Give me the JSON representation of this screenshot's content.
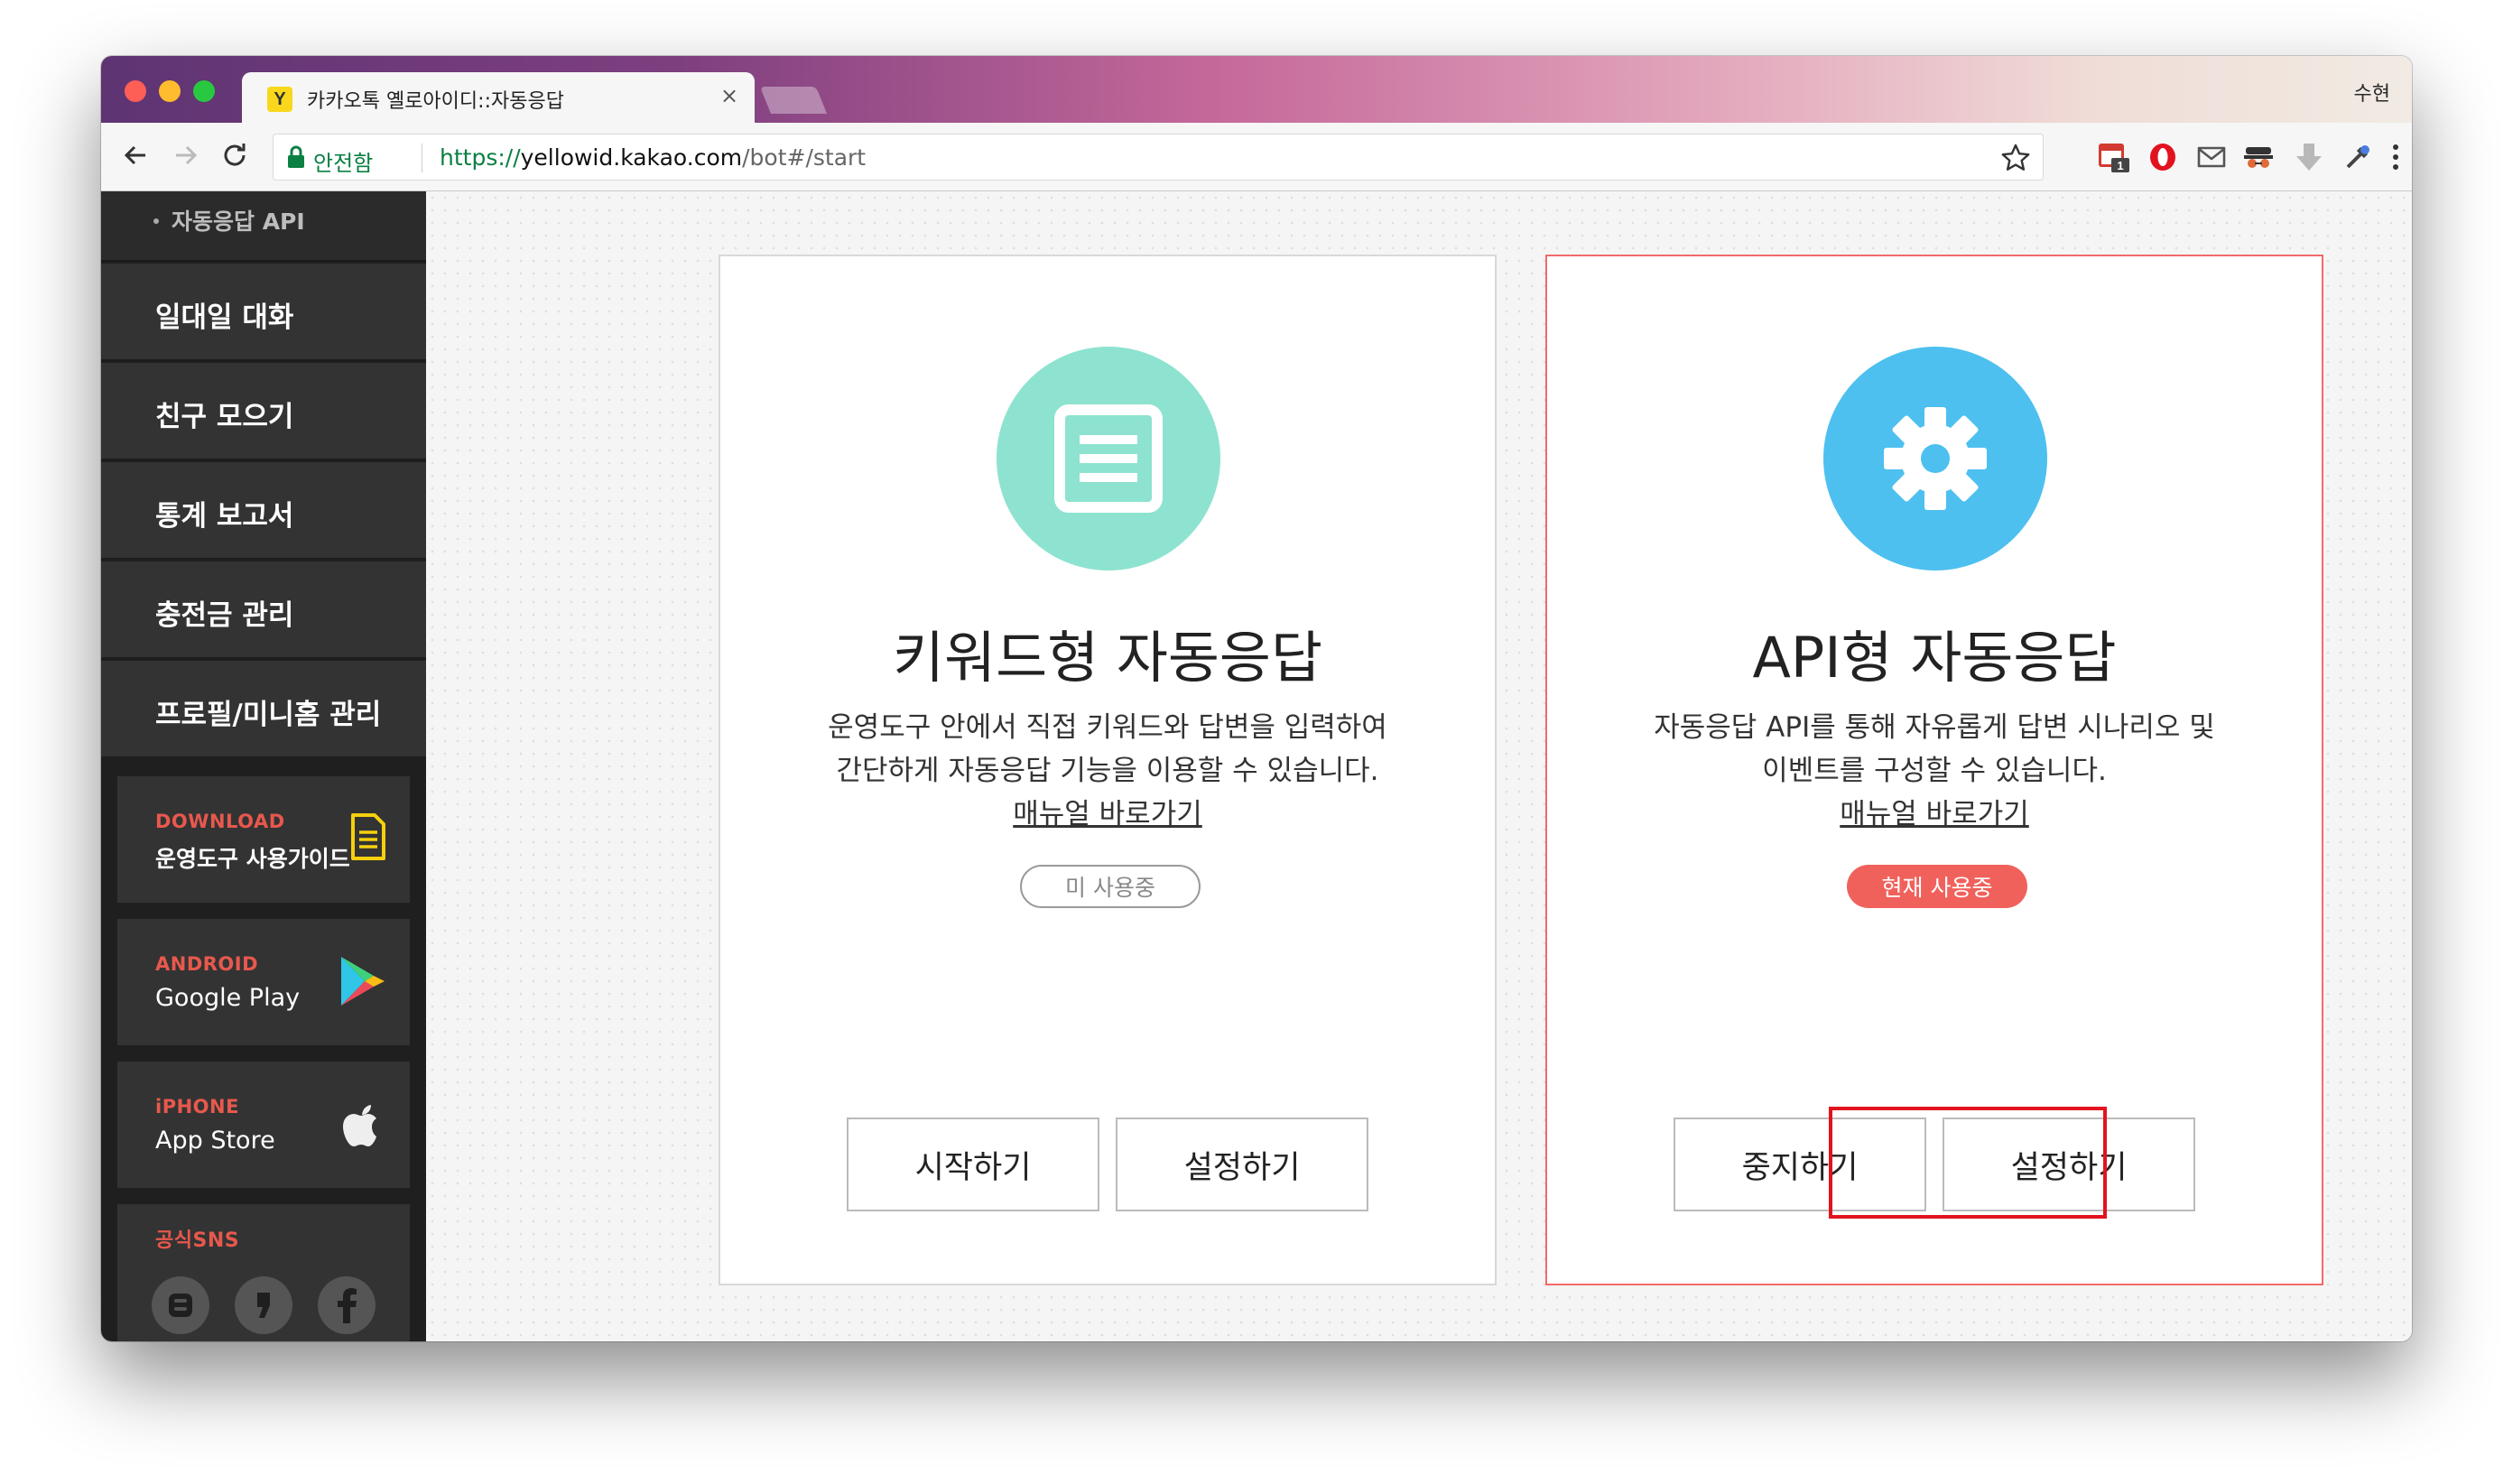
{
  "browser": {
    "tab_title": "카카오톡 옐로아이디::자동응답",
    "favicon_letter": "Y",
    "tab_close": "×",
    "profile_name": "수현",
    "secure_label": "안전함",
    "url_scheme": "https://",
    "url_host": "yellowid.kakao.com",
    "url_path": "/bot#/start",
    "extension_badge": "1"
  },
  "sidebar": {
    "sub_item": "자동응답 API",
    "items": [
      {
        "label": "일대일 대화"
      },
      {
        "label": "친구 모으기"
      },
      {
        "label": "통계 보고서"
      },
      {
        "label": "충전금 관리"
      },
      {
        "label": "프로필/미니홈 관리"
      }
    ],
    "promos": {
      "download": {
        "small": "DOWNLOAD",
        "big": "운영도구 사용가이드"
      },
      "android": {
        "small": "ANDROID",
        "big": "Google Play"
      },
      "iphone": {
        "small": "iPHONE",
        "big": "App Store"
      },
      "sns": {
        "small": "공식SNS"
      }
    }
  },
  "cards": {
    "keyword": {
      "title": "키워드형 자동응답",
      "desc_line1": "운영도구 안에서 직접 키워드와 답변을 입력하여",
      "desc_line2": "간단하게 자동응답 기능을 이용할 수 있습니다.",
      "manual_link": "매뉴얼 바로가기",
      "status": "미 사용중",
      "primary_button": "시작하기",
      "settings_button": "설정하기"
    },
    "api": {
      "title": "API형 자동응답",
      "desc_line1": "자동응답 API를 통해 자유롭게 답변 시나리오 및",
      "desc_line2": "이벤트를 구성할 수 있습니다.",
      "manual_link": "매뉴얼 바로가기",
      "status": "현재 사용중",
      "primary_button": "중지하기",
      "settings_button": "설정하기"
    }
  },
  "colors": {
    "keyword_icon": "#8de3cf",
    "api_icon": "#4dc0ef",
    "active_border": "#f26a68",
    "status_active": "#f1615c",
    "highlight": "#e1131f",
    "secure_green": "#0a8043"
  }
}
